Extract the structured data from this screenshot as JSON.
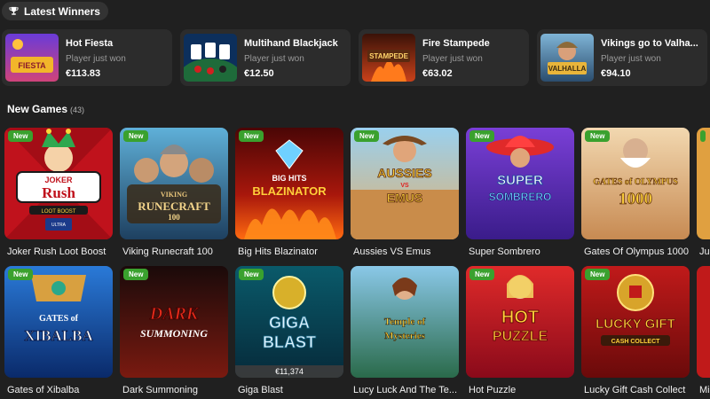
{
  "header": {
    "latest_winners": "Latest Winners"
  },
  "winners": [
    {
      "game": "Hot Fiesta",
      "status": "Player just won",
      "amount": "€113.83",
      "thumb_text": "HOT FIESTA"
    },
    {
      "game": "Multihand Blackjack",
      "status": "Player just won",
      "amount": "€12.50",
      "thumb_text": ""
    },
    {
      "game": "Fire Stampede",
      "status": "Player just won",
      "amount": "€63.02",
      "thumb_text": "FIRE STAMPEDE"
    },
    {
      "game": "Vikings go to Valha...",
      "status": "Player just won",
      "amount": "€94.10",
      "thumb_text": "VIKINGS go to VALHALLA"
    }
  ],
  "new_games": {
    "title": "New Games",
    "count": "(43)",
    "badge": "New",
    "row1": [
      {
        "name": "Joker Rush Loot Boost",
        "logo": "Joker Rush"
      },
      {
        "name": "Viking Runecraft 100",
        "logo": "RUNECRAFT"
      },
      {
        "name": "Big Hits Blazinator",
        "logo": "BLAZINATOR"
      },
      {
        "name": "Aussies VS Emus",
        "logo": "AUSSIES vs EMUS"
      },
      {
        "name": "Super Sombrero",
        "logo": "SUPER SOMBRERO"
      },
      {
        "name": "Gates Of Olympus 1000",
        "logo": "GATES of OLYMPUS 1000"
      }
    ],
    "row2": [
      {
        "name": "Gates of Xibalba",
        "logo": "GATES of XIBALBA"
      },
      {
        "name": "Dark Summoning",
        "logo": "DARK SUMMONING"
      },
      {
        "name": "Giga Blast",
        "logo": "GIGA BLAST",
        "jackpot": "€11,374"
      },
      {
        "name": "Lucy Luck And The Te...",
        "logo": "Temple of Mysteries"
      },
      {
        "name": "Hot Puzzle",
        "logo": "HOT PUZZLE"
      },
      {
        "name": "Lucky Gift Cash Collect",
        "logo": "LUCKY GIFT"
      }
    ],
    "partial_col": {
      "row1": "Ju",
      "row2": "Mi"
    }
  },
  "colors": {
    "badge": "#3aa12e",
    "background": "#202020",
    "card": "#2c2c2c"
  }
}
